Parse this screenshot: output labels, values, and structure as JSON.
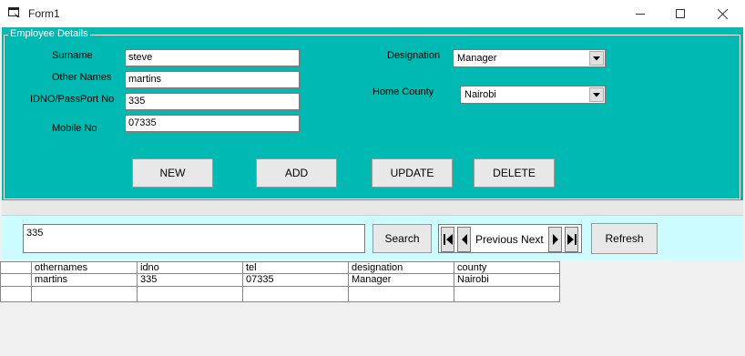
{
  "window": {
    "title": "Form1"
  },
  "details": {
    "caption": "Employee Details",
    "fields": {
      "surname": {
        "label": "Surname",
        "value": "steve"
      },
      "other_names": {
        "label": "Other Names",
        "value": "martins"
      },
      "idno": {
        "label": "IDNO/PassPort No",
        "value": "335"
      },
      "mobile": {
        "label": "Mobile No",
        "value": "07335"
      },
      "designation": {
        "label": "Designation",
        "value": "Manager"
      },
      "home_county": {
        "label": "Home County",
        "value": "Nairobi"
      }
    },
    "buttons": {
      "new": "NEW",
      "add": "ADD",
      "update": "UPDATE",
      "delete": "DELETE"
    }
  },
  "search": {
    "value": "335",
    "button": "Search",
    "nav_label": "Previous Next",
    "refresh": "Refresh"
  },
  "grid": {
    "columns": [
      "othernames",
      "idno",
      "tel",
      "designation",
      "county"
    ],
    "rows": [
      [
        "martins",
        "335",
        "07335",
        "Manager",
        "Nairobi"
      ],
      [
        "",
        "",
        "",
        "",
        ""
      ]
    ]
  },
  "colors": {
    "details_bg": "#00b9b2",
    "search_bg": "#ccfcff"
  }
}
